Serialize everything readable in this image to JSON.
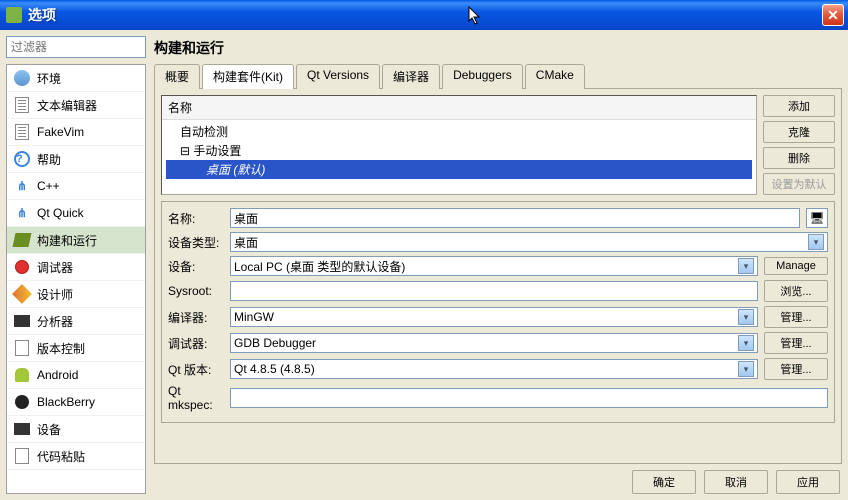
{
  "window": {
    "title": "选项"
  },
  "filter": {
    "placeholder": "过滤器"
  },
  "categories": [
    {
      "label": "环境",
      "icon": "env"
    },
    {
      "label": "文本编辑器",
      "icon": "text"
    },
    {
      "label": "FakeVim",
      "icon": "text"
    },
    {
      "label": "帮助",
      "icon": "help"
    },
    {
      "label": "C++",
      "icon": "cpp"
    },
    {
      "label": "Qt Quick",
      "icon": "cpp"
    },
    {
      "label": "构建和运行",
      "icon": "build",
      "selected": true
    },
    {
      "label": "调试器",
      "icon": "debug"
    },
    {
      "label": "设计师",
      "icon": "design"
    },
    {
      "label": "分析器",
      "icon": "analyzer"
    },
    {
      "label": "版本控制",
      "icon": "vcs"
    },
    {
      "label": "Android",
      "icon": "android"
    },
    {
      "label": "BlackBerry",
      "icon": "bb"
    },
    {
      "label": "设备",
      "icon": "device"
    },
    {
      "label": "代码粘贴",
      "icon": "paste"
    }
  ],
  "page": {
    "title": "构建和运行",
    "tabs": [
      "概要",
      "构建套件(Kit)",
      "Qt Versions",
      "编译器",
      "Debuggers",
      "CMake"
    ],
    "activeTab": 1,
    "tree": {
      "header": "名称",
      "nodes": [
        {
          "label": "自动检测",
          "level": 1
        },
        {
          "label": "手动设置",
          "level": 1,
          "expanded": true
        },
        {
          "label": "桌面 (默认)",
          "level": 2,
          "selected": true
        }
      ]
    },
    "sideButtons": {
      "add": "添加",
      "clone": "克隆",
      "remove": "删除",
      "setDefault": "设置为默认"
    },
    "form": {
      "name": {
        "label": "名称:",
        "value": "桌面"
      },
      "deviceType": {
        "label": "设备类型:",
        "value": "桌面"
      },
      "device": {
        "label": "设备:",
        "value": "Local PC (桌面 类型的默认设备)",
        "button": "Manage"
      },
      "sysroot": {
        "label": "Sysroot:",
        "value": "",
        "button": "浏览..."
      },
      "compiler": {
        "label": "编译器:",
        "value": "MinGW",
        "button": "管理..."
      },
      "debugger": {
        "label": "调试器:",
        "value": "GDB Debugger",
        "button": "管理..."
      },
      "qtVersion": {
        "label": "Qt 版本:",
        "value": "Qt 4.8.5 (4.8.5)",
        "button": "管理..."
      },
      "mkspec": {
        "label": "Qt mkspec:",
        "value": ""
      }
    }
  },
  "dialog": {
    "ok": "确定",
    "cancel": "取消",
    "apply": "应用"
  }
}
